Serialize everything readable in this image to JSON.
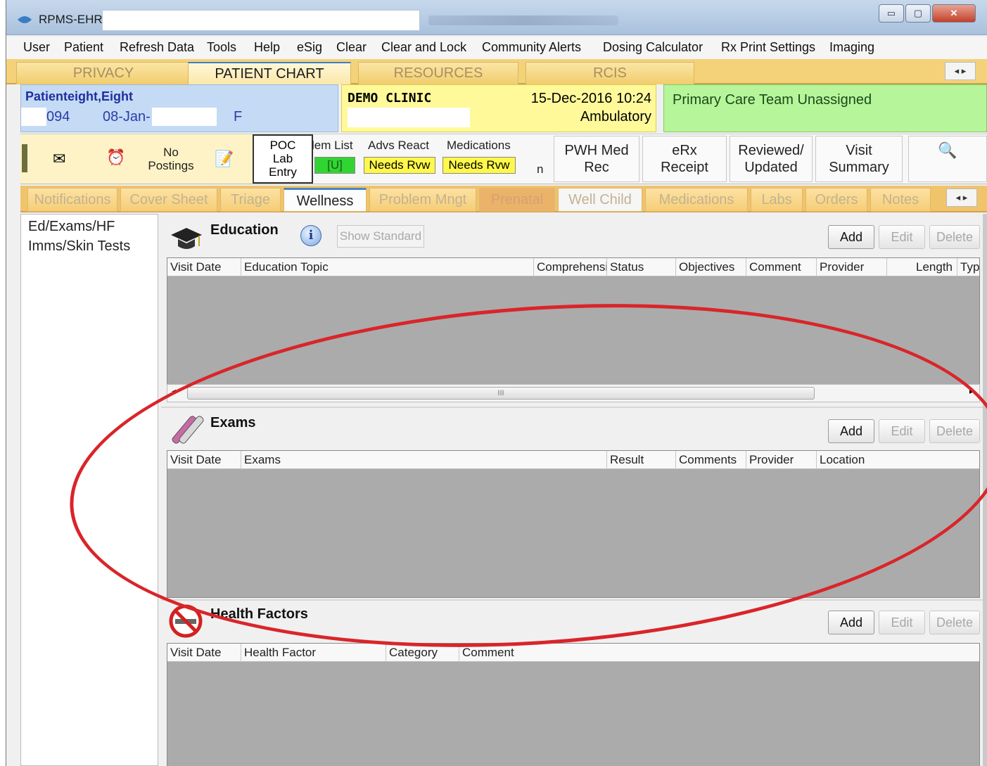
{
  "window": {
    "title": "RPMS-EHR",
    "controls": {
      "minimize": "▭",
      "maximize": "▢",
      "close": "✕"
    }
  },
  "menu": [
    "User",
    "Patient",
    "Refresh Data",
    "Tools",
    "Help",
    "eSig",
    "Clear",
    "Clear and Lock",
    "Community Alerts",
    "Dosing Calculator",
    "Rx Print Settings",
    "Imaging"
  ],
  "top_tabs": [
    "PRIVACY",
    "PATIENT CHART",
    "RESOURCES",
    "RCIS"
  ],
  "patient": {
    "name": "Patienteight,Eight",
    "id": "094",
    "dob": "08-Jan-",
    "sex": "F"
  },
  "visit": {
    "clinic": "DEMO CLINIC",
    "datetime": "15-Dec-2016 10:24",
    "type": "Ambulatory"
  },
  "care_team": "Primary Care Team Unassigned",
  "toolbar": {
    "no_postings": "No\nPostings",
    "poc_lab": "POC\nLab\nEntry",
    "problem_list": "lem List",
    "problem_list_badge": "[U]",
    "advs_react": "Advs React",
    "advs_react_badge": "Needs Rvw",
    "medications": "Medications",
    "medications_badge": "Needs Rvw",
    "n_label": "n",
    "pwh": "PWH Med\nRec",
    "erx": "eRx\nReceipt",
    "reviewed": "Reviewed/\nUpdated",
    "visit_summary": "Visit\nSummary"
  },
  "sub_tabs": [
    "Notifications",
    "Cover Sheet",
    "Triage",
    "Wellness",
    "Problem Mngt",
    "Prenatal",
    "Well Child",
    "Medications",
    "Labs",
    "Orders",
    "Notes"
  ],
  "left_nav": [
    "Ed/Exams/HF",
    "Imms/Skin Tests"
  ],
  "education": {
    "title": "Education",
    "show_standard": "Show Standard",
    "columns": [
      "Visit Date",
      "Education Topic",
      "Comprehensi",
      "Status",
      "Objectives",
      "Comment",
      "Provider",
      "Length",
      "Typ"
    ],
    "scroll_mark": "III"
  },
  "exams": {
    "title": "Exams",
    "columns": [
      "Visit Date",
      "Exams",
      "Result",
      "Comments",
      "Provider",
      "Location"
    ]
  },
  "health_factors": {
    "title": "Health Factors",
    "columns": [
      "Visit Date",
      "Health Factor",
      "Category",
      "Comment"
    ]
  },
  "buttons": {
    "add": "Add",
    "edit": "Edit",
    "delete": "Delete"
  },
  "colors": {
    "patient_banner": "#c5dbf5",
    "visit_banner": "#fff99a",
    "care_team_banner": "#b7f59a",
    "annotation_oval": "#d9252a"
  }
}
